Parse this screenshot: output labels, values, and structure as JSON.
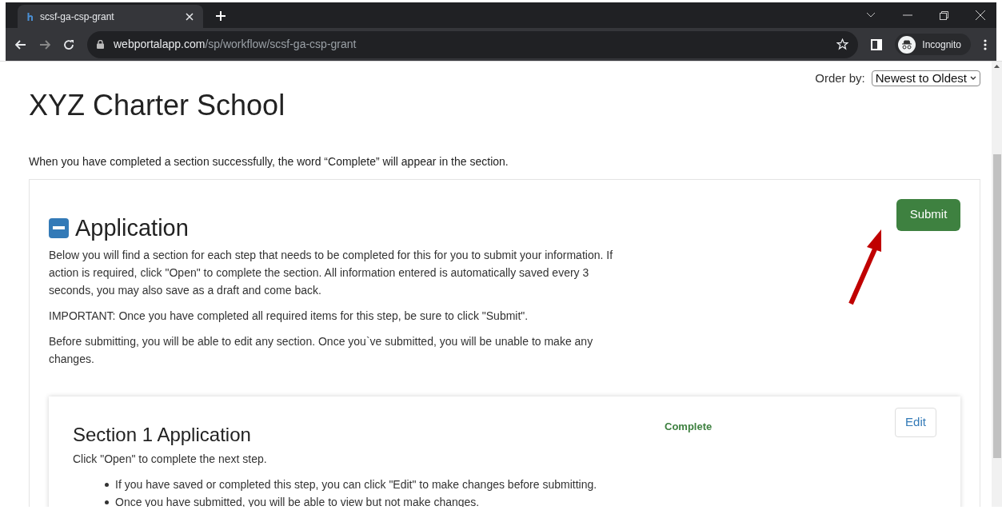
{
  "browser": {
    "tab": {
      "title": "scsf-ga-csp-grant",
      "selected": true
    },
    "url": {
      "host": "webportalapp.com",
      "path": "/sp/workflow/scsf-ga-csp-grant"
    },
    "profile": "Incognito"
  },
  "order_by": {
    "label": "Order by:",
    "value": "Newest to Oldest"
  },
  "page_title": "XYZ Charter School",
  "intro": "When you have completed a section successfully, the word “Complete” will appear in the section.",
  "application": {
    "title": "Application",
    "expanded": true,
    "submit": "Submit",
    "paragraphs": [
      "Below you will find a section for each step that needs to be completed for this for you to submit your information. If action is required, click \"Open\" to complete the section. All information entered is automatically saved every 3 seconds, you may also save as a draft and come back.",
      "IMPORTANT: Once you have completed all required items for this step, be sure to click \"Submit\".",
      "Before submitting, you will be able to edit any section. Once you`ve submitted, you will be unable to make any changes."
    ]
  },
  "sections": [
    {
      "title": "Section 1 Application",
      "status": "Complete",
      "button": "Edit",
      "text": "Click \"Open\" to complete the next step.",
      "bullets": [
        "If you have saved or completed this step, you can click \"Edit\" to make changes before submitting.",
        "Once you have submitted, you will be able to view but not make changes."
      ]
    }
  ]
}
